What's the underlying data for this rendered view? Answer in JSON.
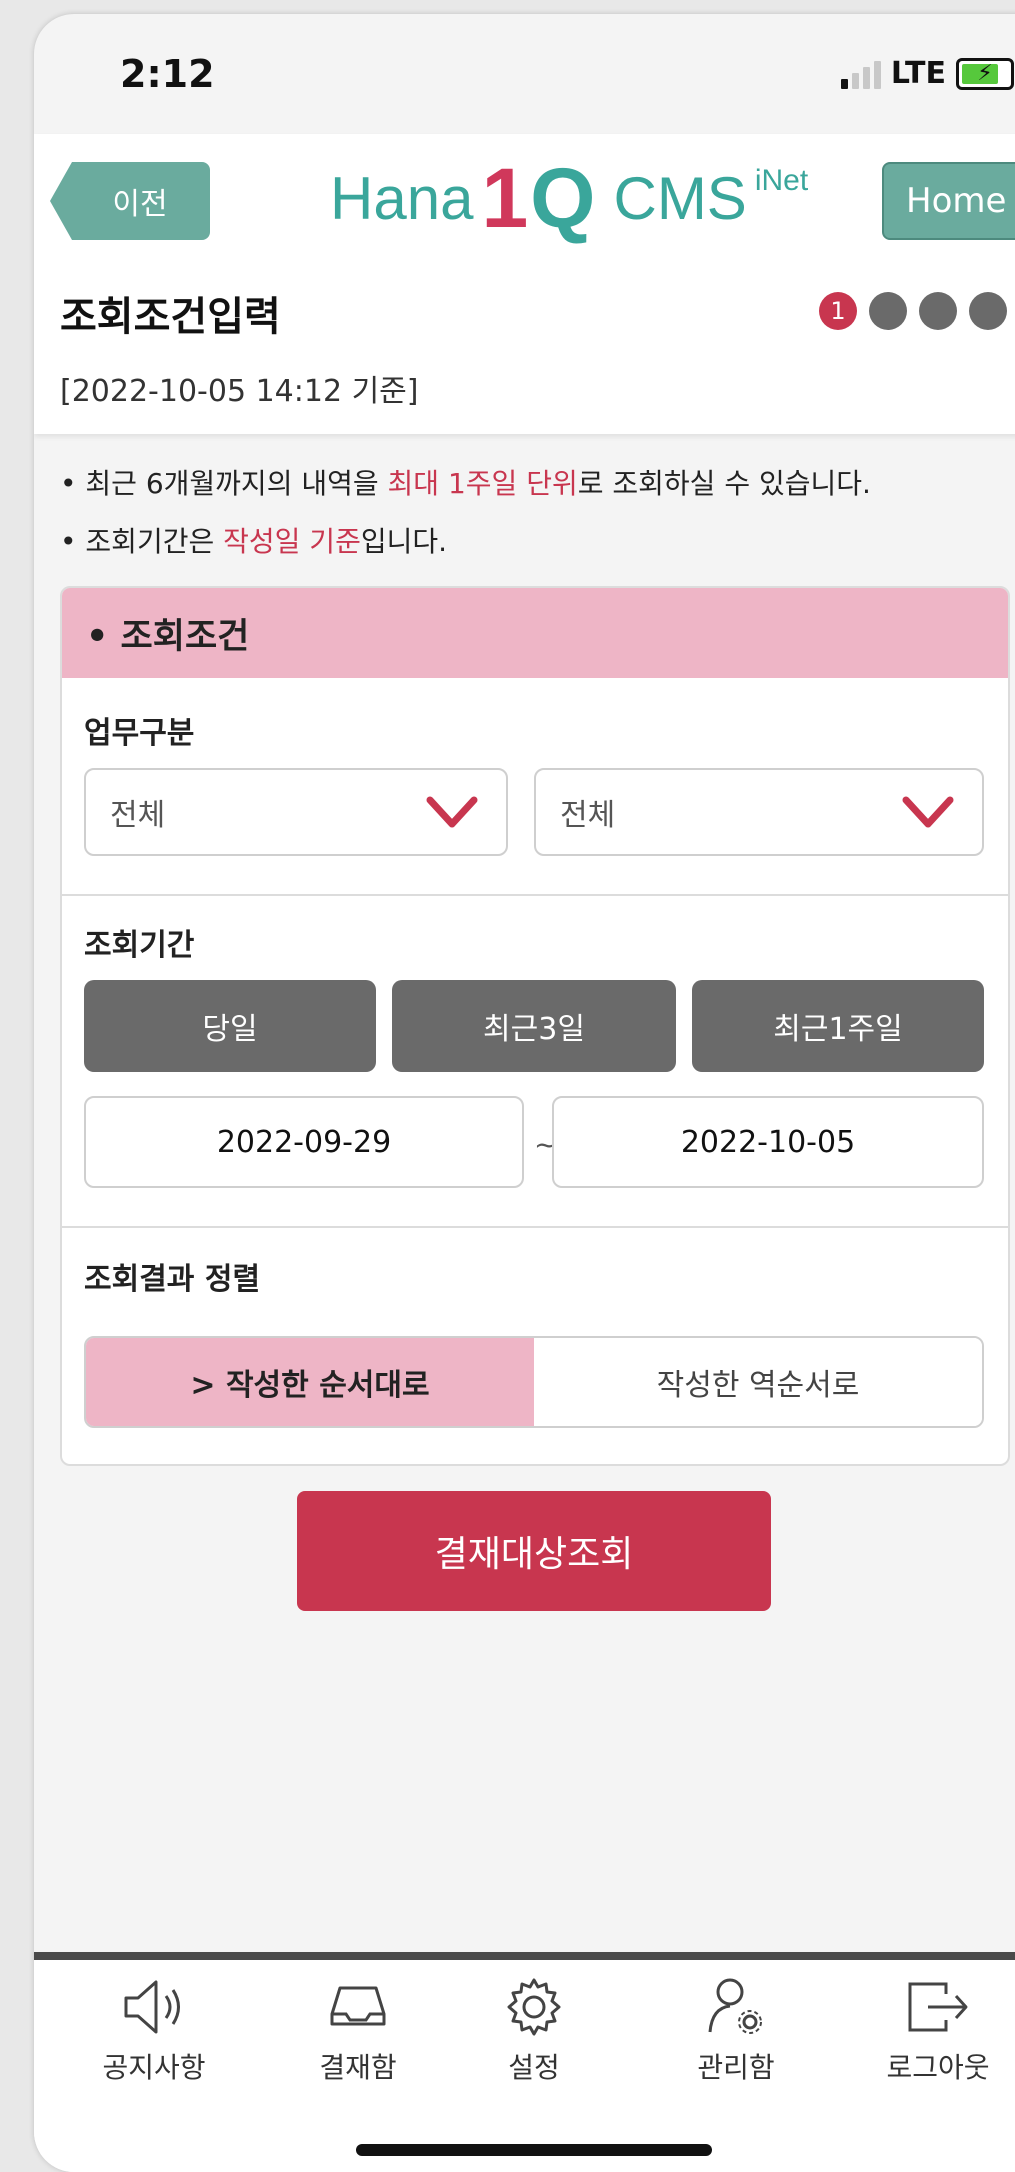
{
  "status_bar": {
    "time": "2:12",
    "network": "LTE"
  },
  "header": {
    "back_label": "이전",
    "logo": {
      "brand": "Hana",
      "one": "1",
      "q": "Q",
      "product": "CMS",
      "suffix": "iNet"
    },
    "home_label": "Home",
    "title": "조회조건입력",
    "subtitle": "[2022-10-05 14:12 기준]",
    "steps": {
      "current": "1",
      "total": 4
    }
  },
  "notices": [
    {
      "before": "최근 6개월까지의 내역을 ",
      "highlight": "최대 1주일 단위",
      "after": "로 조회하실 수 있습니다."
    },
    {
      "before": "조회기간은 ",
      "highlight": "작성일 기준",
      "after": "입니다."
    }
  ],
  "condition_card": {
    "title": "• 조회조건",
    "work_type": {
      "label": "업무구분",
      "select1": "전체",
      "select2": "전체"
    },
    "period": {
      "label": "조회기간",
      "buttons": [
        "당일",
        "최근3일",
        "최근1주일"
      ],
      "start_date": "2022-09-29",
      "separator": "~",
      "end_date": "2022-10-05"
    },
    "sort": {
      "label": "조회결과 정렬",
      "options": [
        "> 작성한 순서대로",
        "작성한 역순서로"
      ],
      "selected_index": 0
    }
  },
  "submit_label": "결재대상조회",
  "tabbar": [
    {
      "label": "공지사항",
      "icon": "speaker-icon"
    },
    {
      "label": "결재함",
      "icon": "inbox-tray-icon"
    },
    {
      "label": "설정",
      "icon": "gear-icon"
    },
    {
      "label": "관리함",
      "icon": "user-settings-icon"
    },
    {
      "label": "로그아웃",
      "icon": "logout-icon"
    }
  ],
  "colors": {
    "accent": "#c8364f",
    "teal": "#6aab9e",
    "pink": "#eeb5c6",
    "gray_button": "#6a6a6a"
  }
}
